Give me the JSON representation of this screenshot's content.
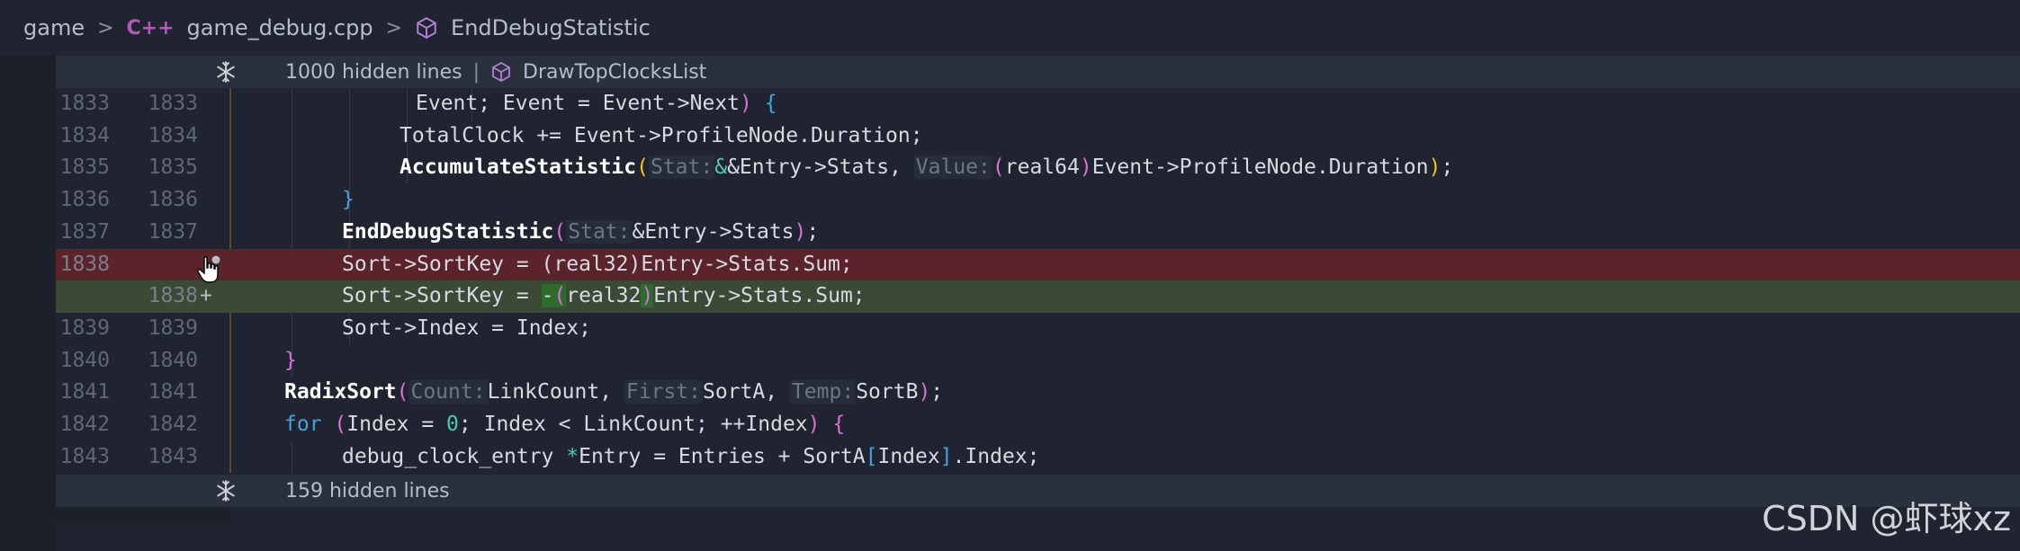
{
  "breadcrumb": {
    "folder": "game",
    "file_icon": "C++",
    "file": "game_debug.cpp",
    "symbol": "EndDebugStatistic",
    "separator": ">"
  },
  "folds": {
    "top": {
      "label": "1000 hidden lines",
      "divider": "|",
      "symbol": "DrawTopClocksList"
    },
    "bottom": {
      "label": "159 hidden lines"
    }
  },
  "lines": [
    {
      "old": "1833",
      "new": "1833"
    },
    {
      "old": "1834",
      "new": "1834"
    },
    {
      "old": "1835",
      "new": "1835"
    },
    {
      "old": "1836",
      "new": "1836"
    },
    {
      "old": "1837",
      "new": "1837"
    },
    {
      "old": "1838",
      "new": ""
    },
    {
      "old": "",
      "new": "1838",
      "marker": "+"
    },
    {
      "old": "1839",
      "new": "1839"
    },
    {
      "old": "1840",
      "new": "1840"
    },
    {
      "old": "1841",
      "new": "1841"
    },
    {
      "old": "1842",
      "new": "1842"
    },
    {
      "old": "1843",
      "new": "1843"
    }
  ],
  "code": {
    "l1833": {
      "a": "Event; Event = Event->Next",
      "b": " {"
    },
    "l1834": "TotalClock += Event->ProfileNode.Duration;",
    "l1835": {
      "fn": "AccumulateStatistic",
      "hint1": "Stat:",
      "arg1": "&Entry->Stats, ",
      "hint2": "Value:",
      "cast": "real64",
      "rest": "Event->ProfileNode.Duration",
      "end": ";"
    },
    "l1836": "}",
    "l1837": {
      "fn": "EndDebugStatistic",
      "hint": "Stat:",
      "arg": "&Entry->Stats",
      "end": ";"
    },
    "l1838_removed": "Sort->SortKey = (real32)Entry->Stats.Sum;",
    "l1838_added": {
      "a": "Sort->SortKey = ",
      "neg": "-",
      "cast": "real32",
      "rest": "Entry->Stats.Sum;"
    },
    "l1839": "Sort->Index = Index;",
    "l1840": "}",
    "l1841": {
      "fn": "RadixSort",
      "hint1": "Count:",
      "arg1": "LinkCount, ",
      "hint2": "First:",
      "arg2": "SortA, ",
      "hint3": "Temp:",
      "arg3": "SortB",
      "end": ";"
    },
    "l1842": {
      "kw": "for",
      "init": "Index = ",
      "zero": "0",
      "cond": "; Index < LinkCount; ",
      "inc": "++Index",
      "end": " {"
    },
    "l1843": {
      "type": "debug_clock_entry ",
      "ptr": "*",
      "a": "Entry = Entries + SortA",
      "idx": "Index",
      "end": ".Index;"
    }
  },
  "watermark": "CSDN @虾球xz",
  "colors": {
    "removed_bg": "#5b232a",
    "added_bg": "#3a4a35",
    "keyword": "#3fa5e0",
    "function": "#ffffff",
    "bracket1": "#f5c518",
    "bracket2": "#da70d6"
  }
}
